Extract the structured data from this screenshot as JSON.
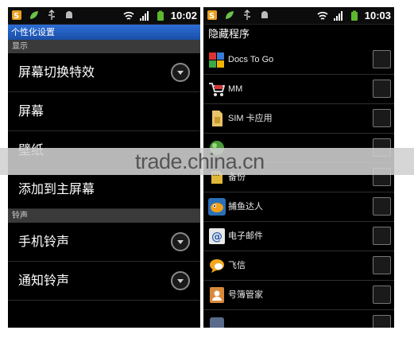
{
  "left": {
    "time": "10:02",
    "title": "个性化设置",
    "sections": [
      {
        "header": "显示",
        "items": [
          {
            "label": "屏幕切换特效",
            "has_dropdown": true
          },
          {
            "label": "屏幕",
            "has_dropdown": false
          },
          {
            "label": "壁纸",
            "has_dropdown": false
          },
          {
            "label": "添加到主屏幕",
            "has_dropdown": false
          }
        ]
      },
      {
        "header": "铃声",
        "items": [
          {
            "label": "手机铃声",
            "has_dropdown": true
          },
          {
            "label": "通知铃声",
            "has_dropdown": true
          }
        ]
      }
    ]
  },
  "right": {
    "time": "10:03",
    "title": "隐藏程序",
    "apps": [
      {
        "label": "Docs To Go",
        "icon": "docs-to-go-icon",
        "checked": false
      },
      {
        "label": "MM",
        "icon": "shopping-cart-icon",
        "checked": false
      },
      {
        "label": "SIM 卡应用",
        "icon": "sim-card-icon",
        "checked": false
      },
      {
        "label": "",
        "icon": "green-orb-icon",
        "checked": false
      },
      {
        "label": "备份",
        "icon": "sd-card-icon",
        "checked": false
      },
      {
        "label": "捕鱼达人",
        "icon": "fish-game-icon",
        "checked": false
      },
      {
        "label": "电子邮件",
        "icon": "email-icon",
        "checked": false
      },
      {
        "label": "飞信",
        "icon": "chat-bubble-icon",
        "checked": false
      },
      {
        "label": "号簿管家",
        "icon": "contacts-book-icon",
        "checked": false
      },
      {
        "label": "",
        "icon": "generic-app-icon",
        "checked": false
      }
    ]
  },
  "watermark": "trade.china.cn",
  "colors": {
    "title_bar": "#1f5cbf",
    "section_header": "#3a3a3a",
    "background": "#000000"
  }
}
